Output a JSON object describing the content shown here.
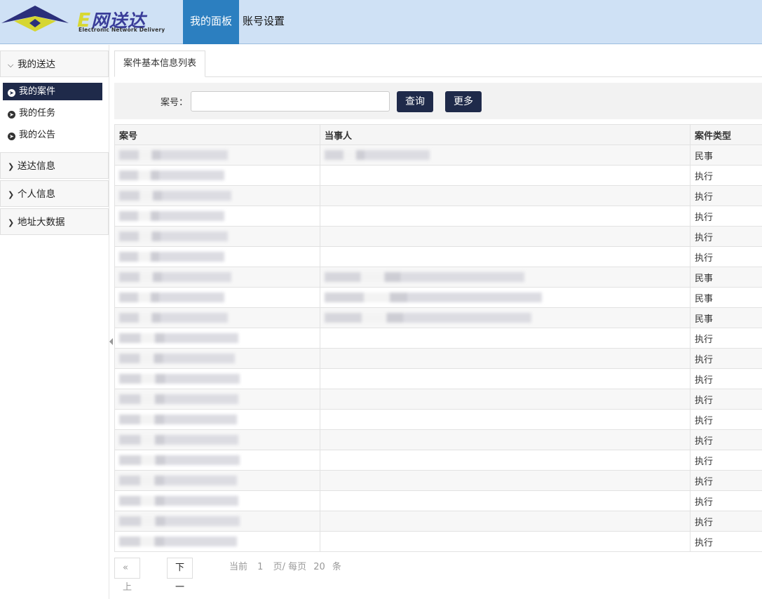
{
  "brand": {
    "logo_text_prefix": "E",
    "logo_text": "网送达",
    "logo_subtitle": "Electronic Network Delivery",
    "colors": {
      "header_bg": "#cfe1f5",
      "nav_active": "#2c7fc0",
      "dark_button": "#1f2a4a"
    }
  },
  "topnav": {
    "items": [
      {
        "label": "我的面板"
      },
      {
        "label": "账号设置"
      }
    ]
  },
  "sidebar": {
    "groups": [
      {
        "label": "我的送达",
        "icon": "chevron-down-icon"
      },
      {
        "label": "送达信息",
        "icon": "chevron-right-icon"
      },
      {
        "label": "个人信息",
        "icon": "chevron-right-icon"
      },
      {
        "label": "地址大数据",
        "icon": "chevron-right-icon"
      }
    ],
    "subitems": [
      {
        "label": "我的案件",
        "icon": "arrow-circle-icon"
      },
      {
        "label": "我的任务",
        "icon": "arrow-circle-icon"
      },
      {
        "label": "我的公告",
        "icon": "arrow-circle-icon"
      }
    ]
  },
  "tab": {
    "label": "案件基本信息列表"
  },
  "search": {
    "label": "案号：",
    "value": "",
    "query_button": "查询",
    "more_button": "更多"
  },
  "table": {
    "headers": [
      "案号",
      "当事人",
      "案件类型"
    ],
    "rows": [
      {
        "case_type": "民事"
      },
      {
        "case_type": "执行"
      },
      {
        "case_type": "执行"
      },
      {
        "case_type": "执行"
      },
      {
        "case_type": "执行"
      },
      {
        "case_type": "执行"
      },
      {
        "case_type": "民事"
      },
      {
        "case_type": "民事"
      },
      {
        "case_type": "民事"
      },
      {
        "case_type": "执行"
      },
      {
        "case_type": "执行"
      },
      {
        "case_type": "执行"
      },
      {
        "case_type": "执行"
      },
      {
        "case_type": "执行"
      },
      {
        "case_type": "执行"
      },
      {
        "case_type": "执行"
      },
      {
        "case_type": "执行"
      },
      {
        "case_type": "执行"
      },
      {
        "case_type": "执行"
      },
      {
        "case_type": "执行"
      }
    ]
  },
  "pager": {
    "prev": "« 上一页",
    "next": "下一页 »",
    "current_label": "当前",
    "current_page": "1",
    "per_page_label": "页/ 每页",
    "per_page": "20",
    "unit": "条"
  }
}
